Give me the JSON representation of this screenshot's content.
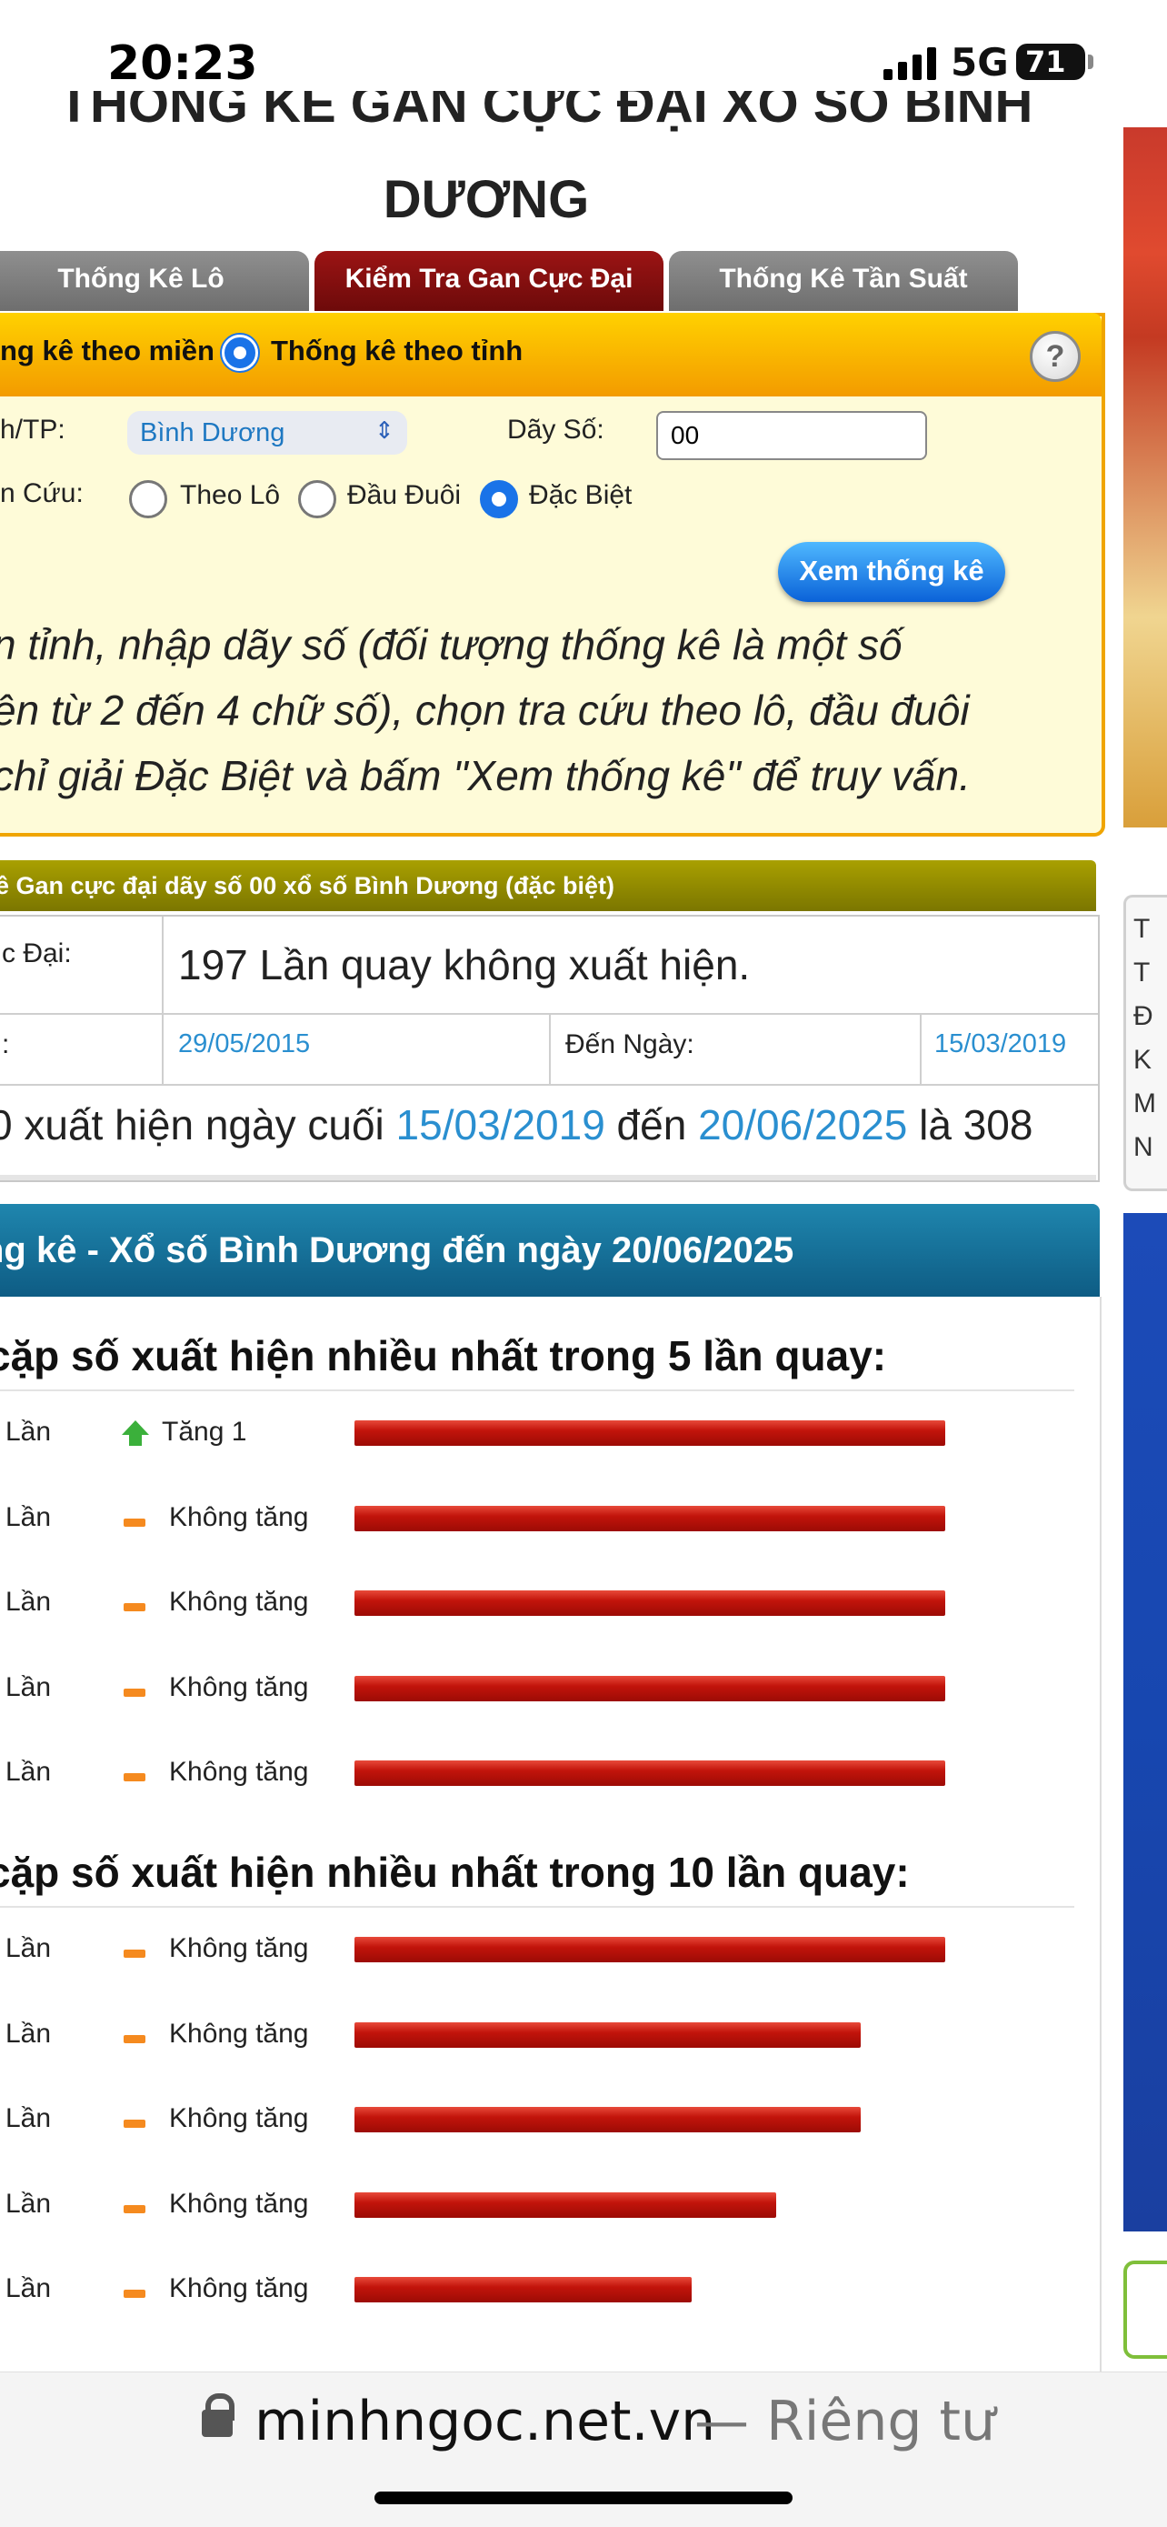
{
  "status_bar": {
    "time": "20:23",
    "network": "5G",
    "battery": "71"
  },
  "page": {
    "title_line1": "THỐNG KÊ GAN CỰC ĐẠI XỔ SỐ BÌNH",
    "title_line2": "DƯƠNG"
  },
  "tabs": [
    {
      "label": "Thống Kê Lô"
    },
    {
      "label": "Kiểm Tra Gan Cực Đại"
    },
    {
      "label": "Thống Kê Tần Suất"
    }
  ],
  "form": {
    "mode_region": "ng kê theo miền",
    "mode_province": "Thống kê theo tỉnh",
    "province_label": "h/TP:",
    "province_value": "Bình Dương",
    "dayso_label": "Dãy Số:",
    "dayso_value": "00",
    "tracuu_label": "n Cứu:",
    "options": [
      "Theo Lô",
      "Đầu Đuôi",
      "Đặc Biệt"
    ],
    "submit": "Xem thống kê",
    "instructions": [
      "n tỉnh, nhập dãy số (đối tượng thống kê là một số",
      "ên từ 2 đến 4 chữ số), chọn tra cứu theo lô, đầu đuôi",
      "chỉ giải Đặc Biệt và bấm \"Xem thống kê\" để truy vấn."
    ]
  },
  "result": {
    "header": "kê Gan cực đại dãy số 00 xổ số Bình Dương (đặc biệt)",
    "max_label": "c Đại:",
    "max_value": "197 Lần quay không xuất hiện.",
    "from_label": ":",
    "from_date": "29/05/2015",
    "to_label": "Đến Ngày:",
    "to_date": "15/03/2019",
    "summary_prefix": "0 xuất hiện ngày cuối ",
    "summary_date1": "15/03/2019",
    "summary_mid": " đến ",
    "summary_date2": "20/06/2025",
    "summary_suffix": " là 308"
  },
  "stats": {
    "header": "ng kê - Xổ số Bình Dương đến ngày 20/06/2025",
    "section1": {
      "title": "cặp số xuất hiện nhiều nhất trong 5 lần quay:",
      "rows": [
        {
          "lan": "Lần",
          "trend": "up",
          "trend_text": "Tăng 1",
          "level": 1.0
        },
        {
          "lan": "Lần",
          "trend": "flat",
          "trend_text": "Không tăng",
          "level": 1.0
        },
        {
          "lan": "Lần",
          "trend": "flat",
          "trend_text": "Không tăng",
          "level": 1.0
        },
        {
          "lan": "Lần",
          "trend": "flat",
          "trend_text": "Không tăng",
          "level": 1.0
        },
        {
          "lan": "Lần",
          "trend": "flat",
          "trend_text": "Không tăng",
          "level": 1.0
        }
      ]
    },
    "section2": {
      "title": "cặp số xuất hiện nhiều nhất trong 10 lần quay:",
      "rows": [
        {
          "lan": "Lần",
          "trend": "flat",
          "trend_text": "Không tăng",
          "level": 1.0
        },
        {
          "lan": "Lần",
          "trend": "flat",
          "trend_text": "Không tăng",
          "level": 0.857
        },
        {
          "lan": "Lần",
          "trend": "flat",
          "trend_text": "Không tăng",
          "level": 0.857
        },
        {
          "lan": "Lần",
          "trend": "flat",
          "trend_text": "Không tăng",
          "level": 0.714
        },
        {
          "lan": "Lần",
          "trend": "flat",
          "trend_text": "Không tăng",
          "level": 0.571
        }
      ]
    }
  },
  "sidebar_letters": [
    "T",
    "T",
    "Đ",
    "K",
    "M",
    "N"
  ],
  "browser": {
    "url": "minhngoc.net.vn",
    "privacy": "— Riêng tư"
  },
  "colors": {
    "tab_active": "#8b0f0f",
    "tab_inactive": "#7d7d7d",
    "form_header": "#f7b500",
    "link_blue": "#2a8fd0",
    "result_header": "#8f8800",
    "stats_header": "#136b96",
    "bar_red": "#c2140b"
  }
}
